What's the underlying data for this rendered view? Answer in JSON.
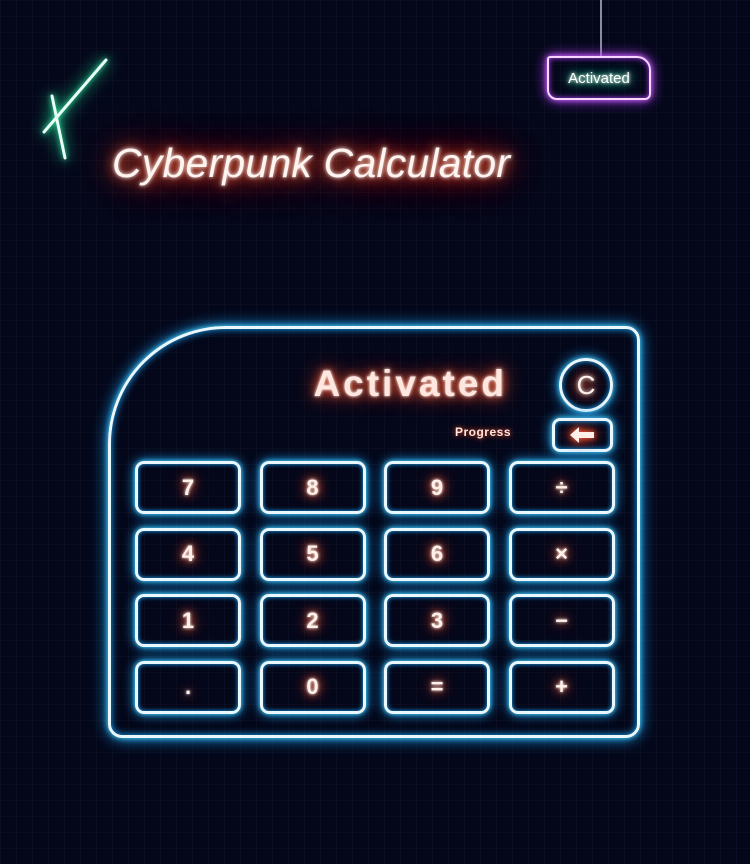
{
  "colors": {
    "background": "#04071a",
    "neon_blue": "#18a8ff",
    "neon_orange": "#ff3b1a",
    "neon_green": "#24e09b",
    "neon_purple": "#b13dff"
  },
  "sign": {
    "label": "Activated"
  },
  "title": "Cyberpunk Calculator",
  "display": {
    "value": "Activated",
    "progress_label": "Progress"
  },
  "controls": {
    "clear_label": "C",
    "backspace_icon": "arrow-left-icon"
  },
  "keypad": {
    "keys": [
      {
        "label": "7",
        "name": "key-7"
      },
      {
        "label": "8",
        "name": "key-8"
      },
      {
        "label": "9",
        "name": "key-9"
      },
      {
        "label": "÷",
        "name": "key-divide"
      },
      {
        "label": "4",
        "name": "key-4"
      },
      {
        "label": "5",
        "name": "key-5"
      },
      {
        "label": "6",
        "name": "key-6"
      },
      {
        "label": "×",
        "name": "key-multiply"
      },
      {
        "label": "1",
        "name": "key-1"
      },
      {
        "label": "2",
        "name": "key-2"
      },
      {
        "label": "3",
        "name": "key-3"
      },
      {
        "label": "−",
        "name": "key-subtract"
      },
      {
        "label": ".",
        "name": "key-decimal"
      },
      {
        "label": "0",
        "name": "key-0"
      },
      {
        "label": "=",
        "name": "key-equals"
      },
      {
        "label": "+",
        "name": "key-add"
      }
    ]
  }
}
